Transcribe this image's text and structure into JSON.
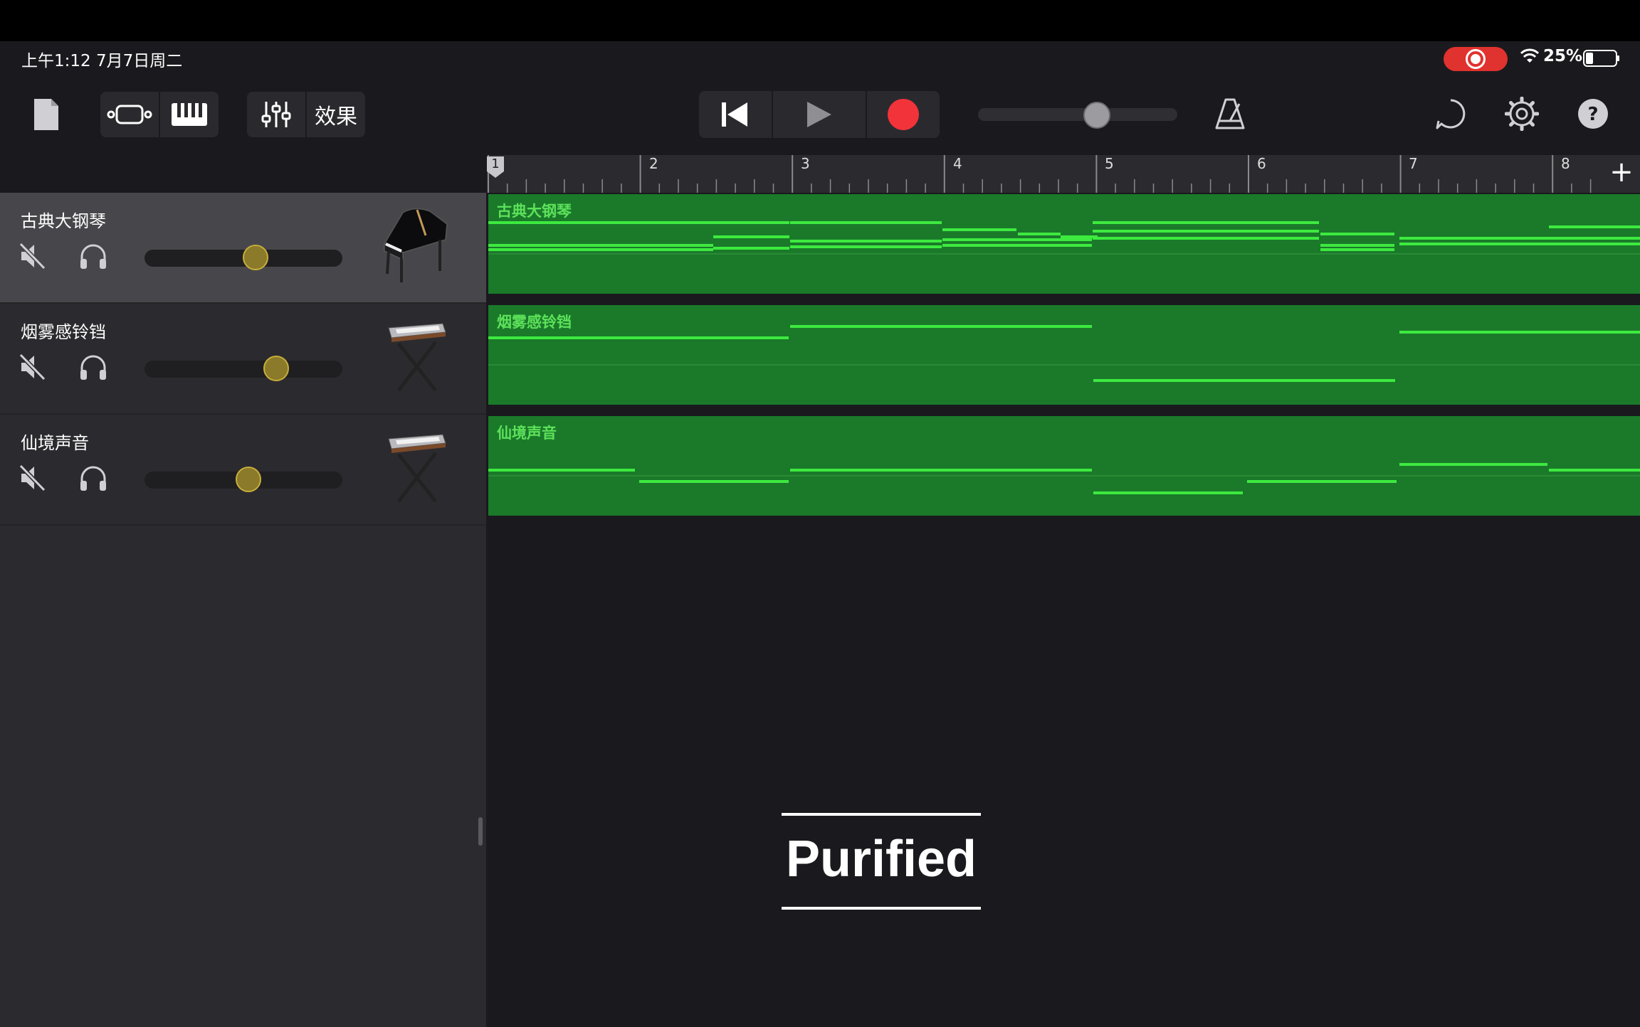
{
  "status_bar": {
    "time": "上午1:12  7月7日周二",
    "battery_percent": "25%",
    "battery_level": 0.25,
    "recording_indicator": true
  },
  "toolbar": {
    "effects_label": "效果",
    "master_volume": 0.6,
    "icons": [
      "document-icon",
      "tracks-view-icon",
      "keyboard-icon",
      "mixer-icon",
      "go-to-start-icon",
      "play-icon",
      "record-icon",
      "metronome-icon",
      "loop-icon",
      "settings-icon",
      "help-icon"
    ]
  },
  "ruler": {
    "bars": [
      "1",
      "2",
      "3",
      "4",
      "5",
      "6",
      "7",
      "8"
    ],
    "add_label": "+"
  },
  "tracks": [
    {
      "name": "古典大钢琴",
      "volume": 0.57,
      "selected": true,
      "instrument": "grand-piano",
      "region_label": "古典大钢琴"
    },
    {
      "name": "烟雾感铃铛",
      "volume": 0.69,
      "selected": false,
      "instrument": "keyboard-stand",
      "region_label": "烟雾感铃铛"
    },
    {
      "name": "仙境声音",
      "volume": 0.53,
      "selected": false,
      "instrument": "keyboard-stand",
      "region_label": "仙境声音"
    }
  ],
  "overlay": {
    "watermark": "Purified"
  },
  "colors": {
    "region": "#1a7a2a",
    "note": "#3dea3f",
    "record": "#f2333a",
    "accent_knob": "#c9ae3a"
  }
}
